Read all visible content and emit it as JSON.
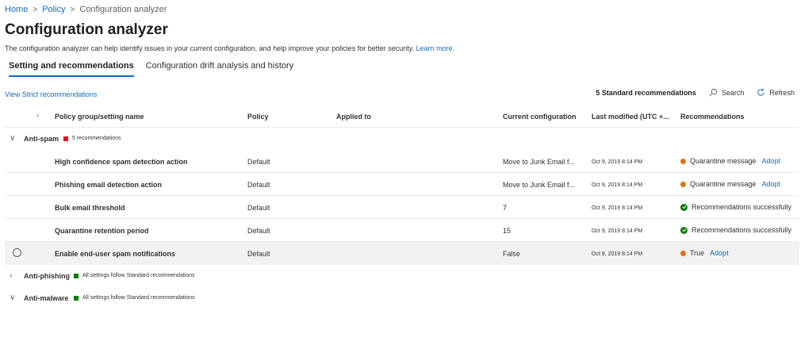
{
  "breadcrumb": {
    "home": "Home",
    "policy": "Policy",
    "current": "Configuration analyzer",
    "sep": ">"
  },
  "page": {
    "title": "Configuration analyzer",
    "description": "The configuration analyzer can help identify issues in your current configuration, and help improve your policies for better security.",
    "learn_more": "Learn more."
  },
  "tabs": [
    {
      "label": "Setting and recommendations",
      "active": true
    },
    {
      "label": "Configuration drift analysis and history",
      "active": false
    }
  ],
  "strict_link": "View Strict recommendations",
  "toolbar": {
    "count": "5 Standard recommendations",
    "search": "Search",
    "refresh": "Refresh"
  },
  "columns": {
    "name": "Policy group/setting name",
    "policy": "Policy",
    "applied_to": "Applied to",
    "current": "Current configuration",
    "modified": "Last modified (UTC +...",
    "recommendations": "Recommendations"
  },
  "colors": {
    "accent": "#0f6cbd",
    "red": "#e81123",
    "green": "#107c10",
    "orange": "#e3730e"
  },
  "groups": [
    {
      "name": "Anti-spam",
      "status": "5 recommendations",
      "status_color": "red",
      "expanded": true
    },
    {
      "name": "Anti-phishing",
      "status": "All settings follow Standard recommendations",
      "status_color": "green",
      "expanded": false
    },
    {
      "name": "Anti-malware",
      "status": "All settings follow Standard recommendations",
      "status_color": "green",
      "expanded": true
    }
  ],
  "rows": [
    {
      "name": "High confidence spam detection action",
      "policy": "Default",
      "current": "Move to Junk Email f...",
      "modified": "Oct 9, 2019 8:14 PM",
      "rec": "Quarantine message",
      "status": "orange",
      "adopt": "Adopt"
    },
    {
      "name": "Phishing email detection action",
      "policy": "Default",
      "current": "Move to Junk Email f...",
      "modified": "Oct 9, 2019 8:14 PM",
      "rec": "Quarantine message",
      "status": "orange",
      "adopt": "Adopt"
    },
    {
      "name": "Bulk email threshold",
      "policy": "Default",
      "current": "7",
      "modified": "Oct 9, 2019 8:14 PM",
      "rec": "Recommendations successfully",
      "status": "green",
      "adopt": ""
    },
    {
      "name": "Quarantine retention period",
      "policy": "Default",
      "current": "15",
      "modified": "Oct 9, 2019 8:14 PM",
      "rec": "Recommendations successfully",
      "status": "green",
      "adopt": ""
    },
    {
      "name": "Enable end-user spam notifications",
      "policy": "Default",
      "current": "False",
      "modified": "Oct 9, 2019 8:14 PM",
      "rec": "True",
      "status": "orange",
      "adopt": "Adopt"
    }
  ]
}
